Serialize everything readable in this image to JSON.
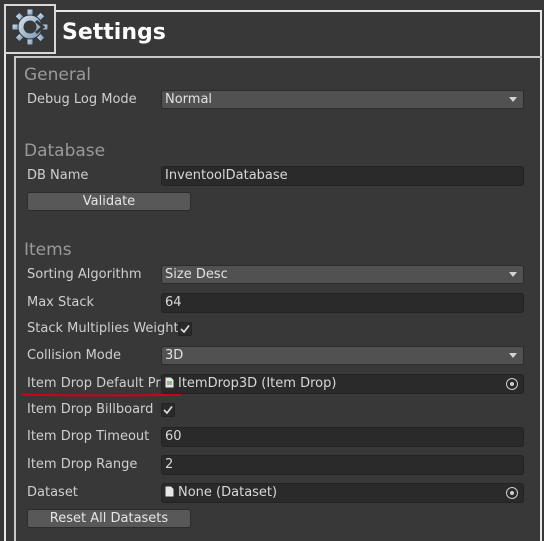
{
  "header": {
    "title": "Settings",
    "logo_icon": "gear-icon"
  },
  "general": {
    "section_title": "General",
    "debug_log_mode": {
      "label": "Debug Log Mode",
      "value": "Normal"
    }
  },
  "database": {
    "section_title": "Database",
    "db_name": {
      "label": "DB Name",
      "value": "InventoolDatabase"
    },
    "validate_label": "Validate"
  },
  "items": {
    "section_title": "Items",
    "sorting_algorithm": {
      "label": "Sorting Algorithm",
      "value": "Size Desc"
    },
    "max_stack": {
      "label": "Max Stack",
      "value": "64"
    },
    "stack_multiplies_weight": {
      "label": "Stack Multiplies Weight",
      "checked": true
    },
    "collision_mode": {
      "label": "Collision Mode",
      "value": "3D"
    },
    "item_drop_default_prefab": {
      "label": "Item Drop Default Prefab",
      "value": "ItemDrop3D (Item Drop)"
    },
    "item_drop_billboard": {
      "label": "Item Drop Billboard",
      "checked": true
    },
    "item_drop_timeout": {
      "label": "Item Drop Timeout",
      "value": "60"
    },
    "item_drop_range": {
      "label": "Item Drop Range",
      "value": "2"
    },
    "dataset": {
      "label": "Dataset",
      "value": "None (Dataset)"
    },
    "reset_all_datasets_label": "Reset All Datasets"
  },
  "colors": {
    "background": "#383838",
    "annotation_underline": "#d0021b"
  }
}
